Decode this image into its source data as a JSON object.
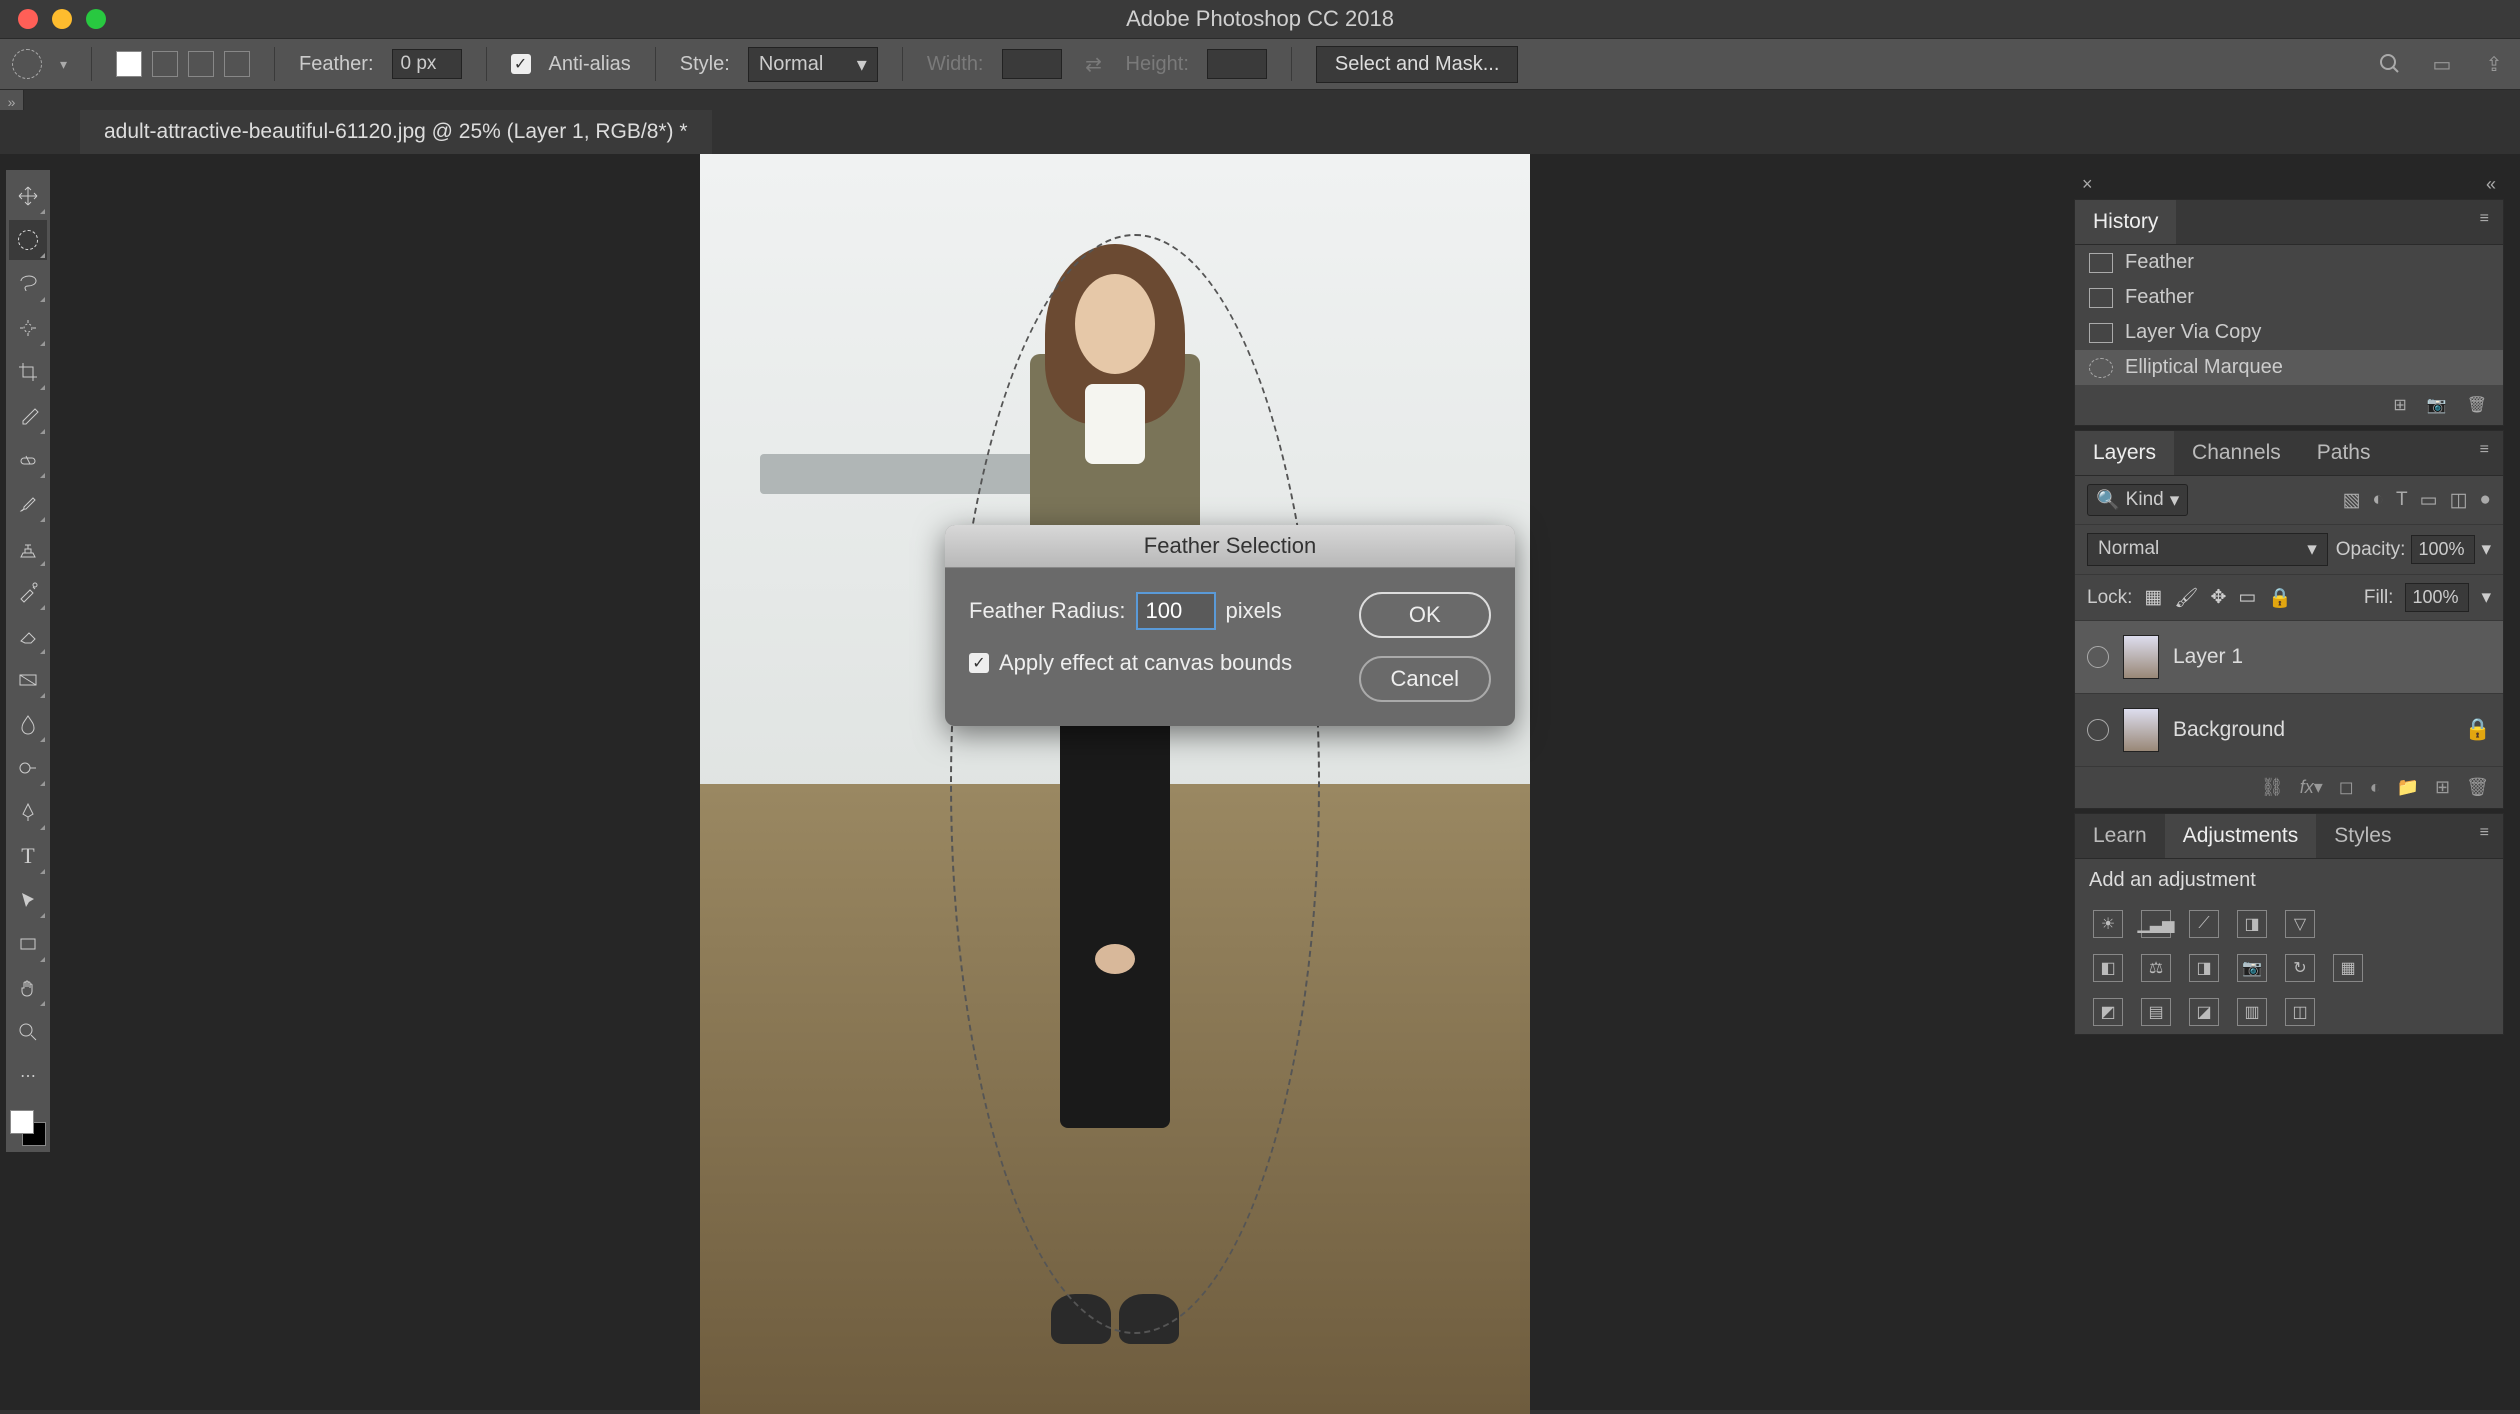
{
  "app": {
    "title": "Adobe Photoshop CC 2018"
  },
  "document": {
    "tab": "adult-attractive-beautiful-61120.jpg @ 25% (Layer 1, RGB/8*) *"
  },
  "optionsBar": {
    "featherLabel": "Feather:",
    "featherValue": "0 px",
    "antiAlias": "Anti-alias",
    "styleLabel": "Style:",
    "styleValue": "Normal",
    "widthLabel": "Width:",
    "heightLabel": "Height:",
    "selectMask": "Select and Mask..."
  },
  "dialog": {
    "title": "Feather Selection",
    "radiusLabel": "Feather Radius:",
    "radiusValue": "100",
    "radiusUnit": "pixels",
    "applyBounds": "Apply effect at canvas bounds",
    "ok": "OK",
    "cancel": "Cancel"
  },
  "historyPanel": {
    "tab": "History",
    "items": [
      "Feather",
      "Feather",
      "Layer Via Copy",
      "Elliptical Marquee"
    ]
  },
  "layersPanel": {
    "tabs": [
      "Layers",
      "Channels",
      "Paths"
    ],
    "kindLabel": "Kind",
    "blendMode": "Normal",
    "opacityLabel": "Opacity:",
    "opacityValue": "100%",
    "lockLabel": "Lock:",
    "fillLabel": "Fill:",
    "fillValue": "100%",
    "layers": [
      {
        "name": "Layer 1",
        "locked": false
      },
      {
        "name": "Background",
        "locked": true
      }
    ]
  },
  "bottomPanel": {
    "tabs": [
      "Learn",
      "Adjustments",
      "Styles"
    ],
    "addLabel": "Add an adjustment"
  }
}
